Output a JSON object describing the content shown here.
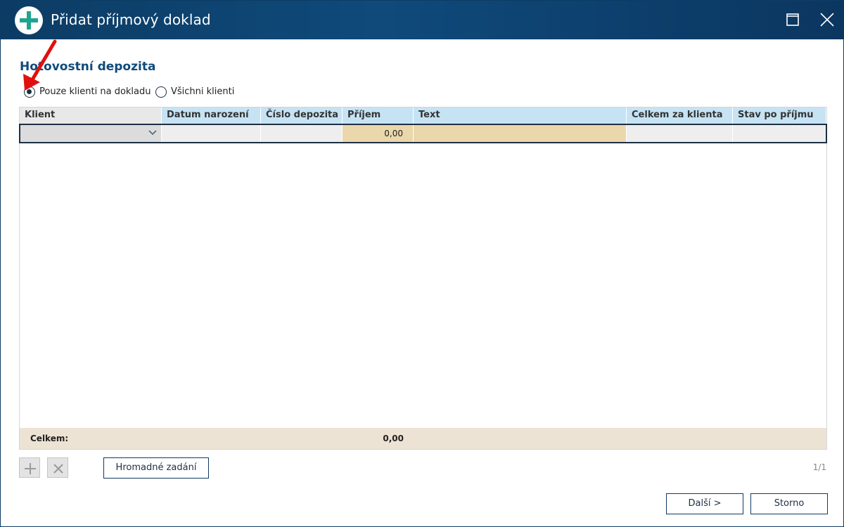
{
  "window": {
    "title": "Přidat příjmový doklad",
    "icons": {
      "badge": "plus-icon",
      "maximize": "maximize-icon",
      "close": "close-icon"
    }
  },
  "section": {
    "title": "Hotovostní depozita"
  },
  "filter": {
    "options": [
      {
        "label": "Pouze klienti na dokladu",
        "selected": true
      },
      {
        "label": "Všichni klienti",
        "selected": false
      }
    ]
  },
  "grid": {
    "columns": [
      "Klient",
      "Datum narození",
      "Číslo depozita",
      "Příjem",
      "Text",
      "Celkem za klienta",
      "Stav po příjmu"
    ],
    "rows": [
      {
        "klient": "",
        "datum_narozeni": "",
        "cislo_depozita": "",
        "prijem": "0,00",
        "text": "",
        "celkem_za_klienta": "",
        "stav_po_prijmu": ""
      }
    ],
    "footer": {
      "label": "Celkem:",
      "total_prijem": "0,00"
    }
  },
  "toolbar": {
    "add_icon": "plus-icon",
    "delete_icon": "x-icon",
    "bulk_label": "Hromadné zadání",
    "page_indicator": "1/1"
  },
  "actions": {
    "next_label": "Další >",
    "cancel_label": "Storno"
  },
  "colors": {
    "titlebar": "#0c3c64",
    "accent_green": "#1fa58e",
    "header_blue": "#c6e3f4",
    "highlight_tan": "#ead7ab",
    "footer_beige": "#ede3d4",
    "annotation_red": "#e01010"
  }
}
